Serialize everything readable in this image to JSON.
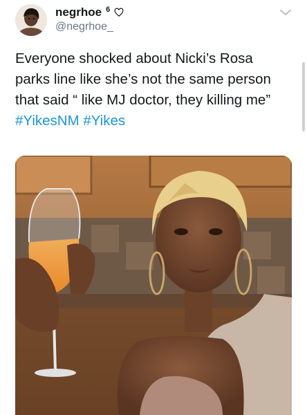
{
  "tweet": {
    "display_name": "negrhoe",
    "badge_number": "6",
    "handle": "@negrhoe_",
    "lines": [
      "Everyone shocked about Nicki’s Rosa",
      "parks line like she’s not the same person",
      "that said “ like MJ doctor, they killing me”"
    ],
    "hashtags": [
      "#YikesNM",
      "#Yikes"
    ]
  },
  "icons": {
    "heart": "heart-icon",
    "chevron": "chevron-down-icon"
  },
  "colors": {
    "link": "#1b95e0",
    "muted": "#657786"
  }
}
